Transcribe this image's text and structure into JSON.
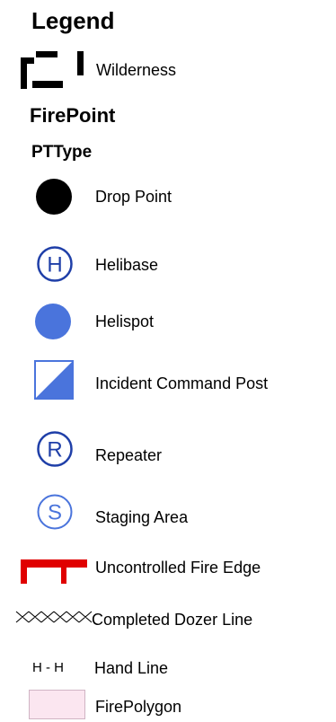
{
  "legend": {
    "title": "Legend",
    "wilderness": {
      "label": "Wilderness",
      "icon": "dashed-boundary-icon",
      "color": "#000000"
    },
    "firepoint": {
      "layer_title": "FirePoint",
      "field_title": "PTType",
      "items": [
        {
          "label": "Drop Point",
          "icon": "filled-black-circle-icon",
          "color": "#000000"
        },
        {
          "label": "Helibase",
          "icon": "circle-h-icon",
          "color": "#1f3fa8"
        },
        {
          "label": "Helispot",
          "icon": "filled-blue-circle-icon",
          "color": "#4a74dc"
        },
        {
          "label": "Incident Command Post",
          "icon": "half-filled-square-icon",
          "color": "#4a74dc"
        },
        {
          "label": "Repeater",
          "icon": "circle-r-icon",
          "color": "#1f3fa8"
        },
        {
          "label": "Staging Area",
          "icon": "circle-s-icon",
          "color": "#4a74dc"
        }
      ]
    },
    "lines": [
      {
        "label": "Uncontrolled Fire Edge",
        "icon": "red-fire-edge-icon",
        "color": "#e00000"
      },
      {
        "label": "Completed Dozer Line",
        "icon": "crosshatch-line-icon",
        "color": "#000000"
      },
      {
        "label": "Hand Line",
        "icon": "h-dash-h-line-icon",
        "symbol": "H - H",
        "color": "#000000"
      }
    ],
    "polygon": {
      "label": "FirePolygon",
      "icon": "pink-fill-swatch-icon",
      "fill": "#fbe6f0",
      "stroke": "#d0b4c4"
    }
  }
}
